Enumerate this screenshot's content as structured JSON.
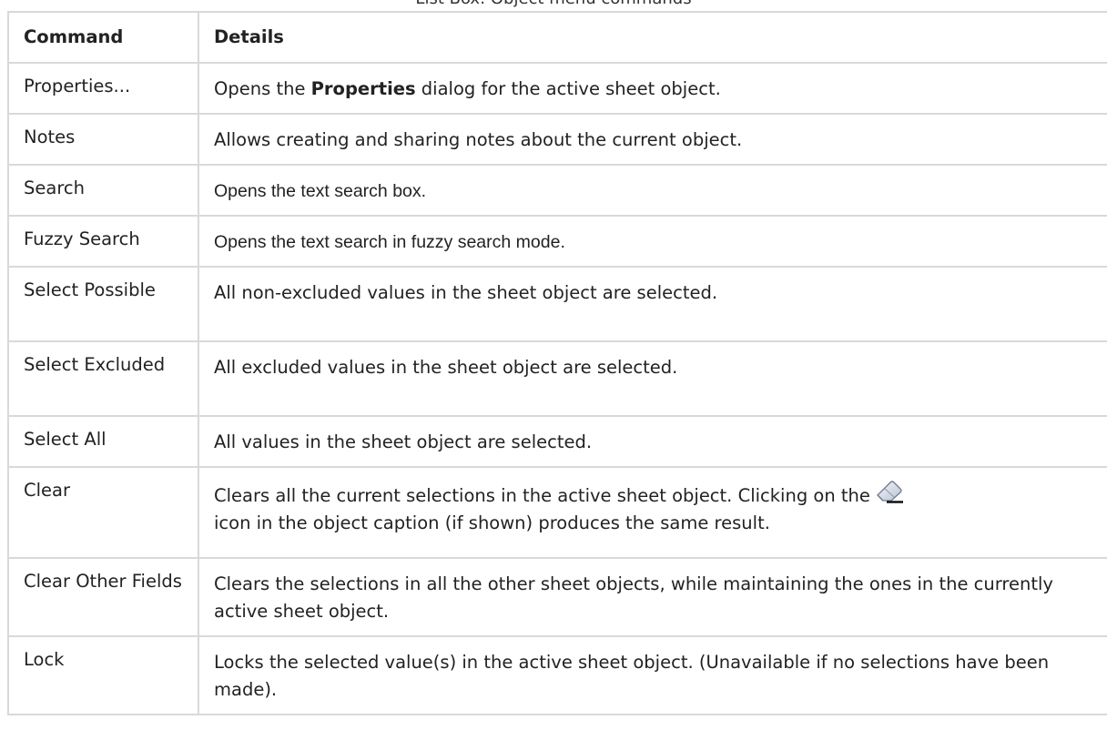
{
  "caption": "List Box: Object menu commands",
  "table": {
    "headers": [
      "Command",
      "Details"
    ],
    "rows": [
      {
        "command": "Properties...",
        "details_before": "Opens the ",
        "details_bold": "Properties",
        "details_after": " dialog for the active sheet object."
      },
      {
        "command": "Notes",
        "details": "Allows creating and sharing notes about the current object."
      },
      {
        "command": "Search",
        "details": "Opens the text search box."
      },
      {
        "command": "Fuzzy Search",
        "details": "Opens the text search in fuzzy search mode."
      },
      {
        "command": "Select Possible",
        "details": "All non-excluded values in the sheet object are selected."
      },
      {
        "command": "Select Excluded",
        "details": "All excluded values in the sheet object are selected."
      },
      {
        "command": "Select All",
        "details": "All values in the sheet object are selected."
      },
      {
        "command": "Clear",
        "details_before": "Clears all the current selections in the active sheet object. Clicking on the",
        "details_after": "icon in the object caption (if shown) produces the same result.",
        "icon": "eraser-icon"
      },
      {
        "command": "Clear Other Fields",
        "details": "Clears the selections in all the other sheet objects, while maintaining the ones in the currently active sheet object."
      },
      {
        "command": "Lock",
        "details": "Locks the selected value(s) in the active sheet object. (Unavailable if no selections have been made)."
      }
    ]
  }
}
